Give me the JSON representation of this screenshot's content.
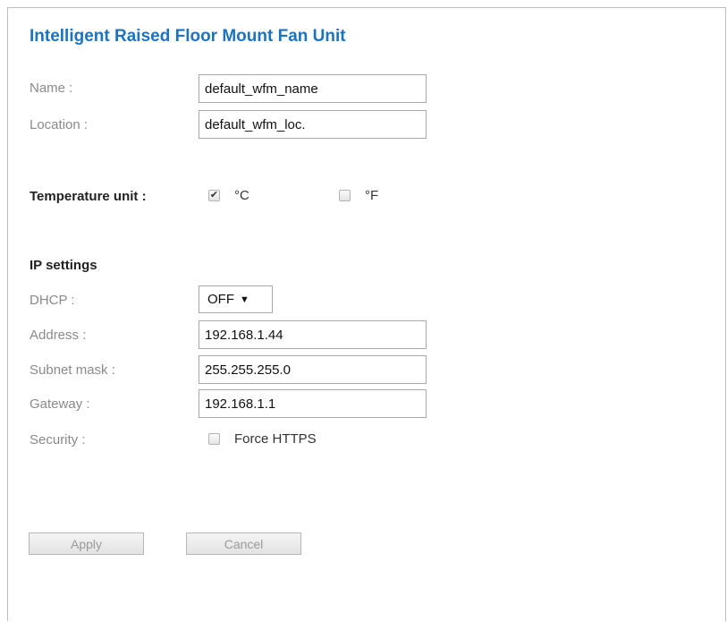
{
  "page": {
    "title": "Intelligent Raised Floor Mount Fan Unit"
  },
  "general": {
    "name_label": "Name :",
    "name_value": "default_wfm_name",
    "location_label": "Location :",
    "location_value": "default_wfm_loc."
  },
  "temperature": {
    "label": "Temperature unit :",
    "celsius_label": "°C",
    "celsius_checked": true,
    "fahrenheit_label": "°F",
    "fahrenheit_checked": false
  },
  "ip": {
    "heading": "IP settings",
    "dhcp_label": "DHCP :",
    "dhcp_value": "OFF",
    "address_label": "Address :",
    "address_value": "192.168.1.44",
    "subnet_label": "Subnet mask :",
    "subnet_value": "255.255.255.0",
    "gateway_label": "Gateway :",
    "gateway_value": "192.168.1.1",
    "security_label": "Security :",
    "https_label": "Force HTTPS",
    "https_checked": false
  },
  "actions": {
    "apply_label": "Apply",
    "cancel_label": "Cancel"
  },
  "icons": {
    "checkmark": "check-icon",
    "dropdown_arrow": "caret-down-icon"
  }
}
